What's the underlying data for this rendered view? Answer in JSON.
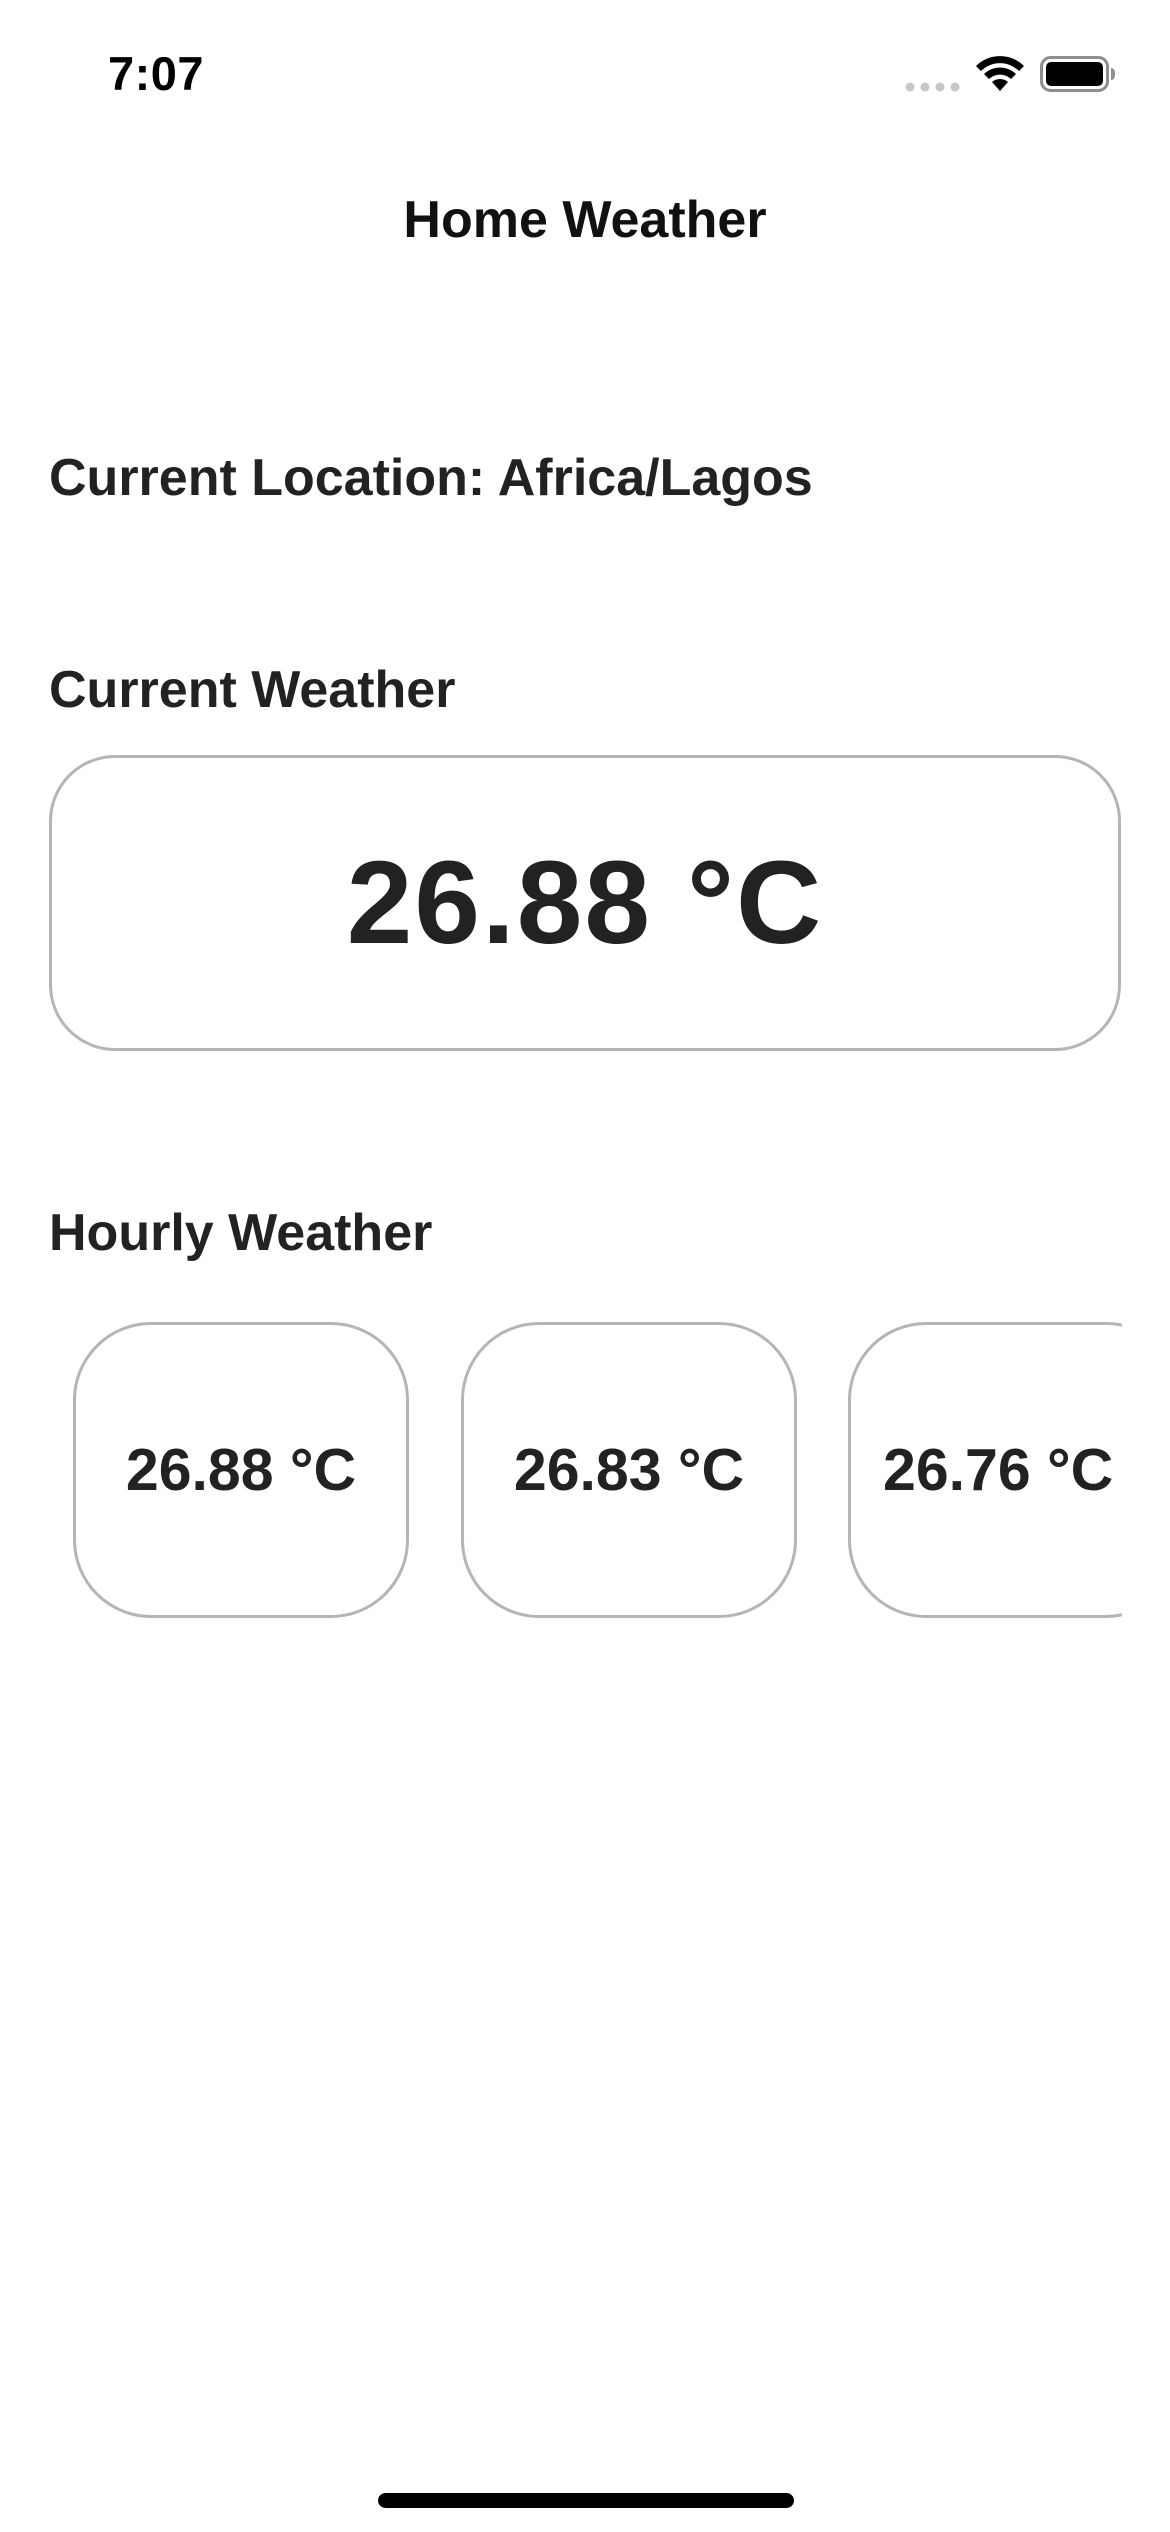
{
  "status_bar": {
    "time": "7:07",
    "icons": [
      "cellular-signal-icon",
      "wifi-icon",
      "battery-icon"
    ]
  },
  "nav": {
    "title": "Home Weather"
  },
  "location": {
    "label": "Current Location: Africa/Lagos"
  },
  "current_weather": {
    "title": "Current Weather",
    "temperature": "26.88 °C"
  },
  "hourly_weather": {
    "title": "Hourly Weather",
    "items": [
      {
        "temperature": "26.88 °C"
      },
      {
        "temperature": "26.83 °C"
      },
      {
        "temperature": "26.76 °C"
      }
    ]
  },
  "colors": {
    "text": "#222222",
    "card_border": "#b5b5b5",
    "background": "#ffffff"
  }
}
